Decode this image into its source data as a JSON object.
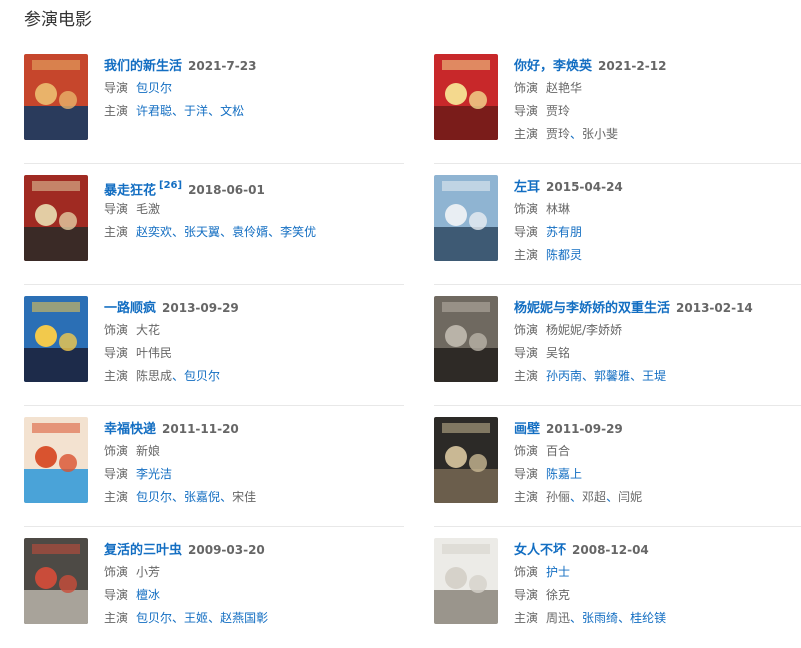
{
  "section_title": "参演电影",
  "films": [
    {
      "title": "我们的新生活",
      "sup": "",
      "date": "2021-7-23",
      "colors": [
        "#c6462c",
        "#e9b36a",
        "#2a3b5c"
      ],
      "rows": [
        {
          "label": "导演",
          "items": [
            {
              "text": "包贝尔",
              "link": true
            }
          ]
        },
        {
          "label": "主演",
          "items": [
            {
              "text": "许君聪",
              "link": true
            },
            {
              "text": "于洋",
              "link": true
            },
            {
              "text": "文松",
              "link": true
            }
          ]
        }
      ]
    },
    {
      "title": "你好，李焕英",
      "sup": "",
      "date": "2021-2-12",
      "colors": [
        "#c8282a",
        "#f4d98e",
        "#7a1c1a"
      ],
      "rows": [
        {
          "label": "饰演",
          "items": [
            {
              "text": "赵艳华",
              "link": false
            }
          ]
        },
        {
          "label": "导演",
          "items": [
            {
              "text": "贾玲",
              "link": false
            }
          ]
        },
        {
          "label": "主演",
          "items": [
            {
              "text": "贾玲",
              "link": false
            },
            {
              "text": "张小斐",
              "link": false
            }
          ]
        }
      ]
    },
    {
      "title": "暴走狂花",
      "sup": "[26]",
      "date": "2018-06-01",
      "colors": [
        "#a02a22",
        "#e3cda4",
        "#3a2a26"
      ],
      "rows": [
        {
          "label": "导演",
          "items": [
            {
              "text": "毛激",
              "link": false
            }
          ]
        },
        {
          "label": "主演",
          "items": [
            {
              "text": "赵奕欢",
              "link": true
            },
            {
              "text": "张天翼",
              "link": true
            },
            {
              "text": "袁伶婿",
              "link": true
            },
            {
              "text": "李笑优",
              "link": true
            }
          ]
        }
      ]
    },
    {
      "title": "左耳",
      "sup": "",
      "date": "2015-04-24",
      "colors": [
        "#8fb4d2",
        "#e9eef3",
        "#3e5a74"
      ],
      "rows": [
        {
          "label": "饰演",
          "items": [
            {
              "text": "林琳",
              "link": false
            }
          ]
        },
        {
          "label": "导演",
          "items": [
            {
              "text": "苏有朋",
              "link": true
            }
          ]
        },
        {
          "label": "主演",
          "items": [
            {
              "text": "陈都灵",
              "link": true
            }
          ]
        }
      ]
    },
    {
      "title": "一路顺疯",
      "sup": "",
      "date": "2013-09-29",
      "colors": [
        "#2b6fb5",
        "#f2c94c",
        "#1d2b4a"
      ],
      "rows": [
        {
          "label": "饰演",
          "items": [
            {
              "text": "大花",
              "link": false
            }
          ]
        },
        {
          "label": "导演",
          "items": [
            {
              "text": "叶伟民",
              "link": false
            }
          ]
        },
        {
          "label": "主演",
          "items": [
            {
              "text": "陈思成",
              "link": false
            },
            {
              "text": "包贝尔",
              "link": true
            }
          ]
        }
      ]
    },
    {
      "title": "杨妮妮与李娇娇的双重生活",
      "sup": "",
      "date": "2013-02-14",
      "colors": [
        "#6f6960",
        "#b9b3a8",
        "#2e2a26"
      ],
      "rows": [
        {
          "label": "饰演",
          "items": [
            {
              "text": "杨妮妮/李娇娇",
              "link": false
            }
          ]
        },
        {
          "label": "导演",
          "items": [
            {
              "text": "吴铭",
              "link": false
            }
          ]
        },
        {
          "label": "主演",
          "items": [
            {
              "text": "孙丙南",
              "link": true
            },
            {
              "text": "郭馨雅",
              "link": true
            },
            {
              "text": "王堤",
              "link": true
            }
          ]
        }
      ]
    },
    {
      "title": "幸福快递",
      "sup": "",
      "date": "2011-11-20",
      "colors": [
        "#f3e2d0",
        "#d9532f",
        "#4aa3d8"
      ],
      "rows": [
        {
          "label": "饰演",
          "items": [
            {
              "text": "新娘",
              "link": false
            }
          ]
        },
        {
          "label": "导演",
          "items": [
            {
              "text": "李光洁",
              "link": true
            }
          ]
        },
        {
          "label": "主演",
          "items": [
            {
              "text": "包贝尔",
              "link": true
            },
            {
              "text": "张嘉倪",
              "link": true
            },
            {
              "text": "宋佳",
              "link": false
            }
          ]
        }
      ]
    },
    {
      "title": "画壁",
      "sup": "",
      "date": "2011-09-29",
      "colors": [
        "#2c2a27",
        "#c9b894",
        "#6b5e4c"
      ],
      "rows": [
        {
          "label": "饰演",
          "items": [
            {
              "text": "百合",
              "link": false
            }
          ]
        },
        {
          "label": "导演",
          "items": [
            {
              "text": "陈嘉上",
              "link": true
            }
          ]
        },
        {
          "label": "主演",
          "items": [
            {
              "text": "孙俪",
              "link": false
            },
            {
              "text": "邓超",
              "link": false
            },
            {
              "text": "闫妮",
              "link": false
            }
          ]
        }
      ]
    },
    {
      "title": "复活的三叶虫",
      "sup": "",
      "date": "2009-03-20",
      "colors": [
        "#4d4a45",
        "#c94c3a",
        "#a8a39a"
      ],
      "rows": [
        {
          "label": "饰演",
          "items": [
            {
              "text": "小芳",
              "link": false
            }
          ]
        },
        {
          "label": "导演",
          "items": [
            {
              "text": "檀冰",
              "link": true
            }
          ]
        },
        {
          "label": "主演",
          "items": [
            {
              "text": "包贝尔",
              "link": true
            },
            {
              "text": "王姬",
              "link": true
            },
            {
              "text": "赵燕国彰",
              "link": true
            }
          ]
        }
      ]
    },
    {
      "title": "女人不坏",
      "sup": "",
      "date": "2008-12-04",
      "colors": [
        "#ecebe7",
        "#d6d2ca",
        "#9a958c"
      ],
      "rows": [
        {
          "label": "饰演",
          "items": [
            {
              "text": "护士",
              "link": true
            }
          ]
        },
        {
          "label": "导演",
          "items": [
            {
              "text": "徐克",
              "link": false
            }
          ]
        },
        {
          "label": "主演",
          "items": [
            {
              "text": "周迅",
              "link": false
            },
            {
              "text": "张雨绮",
              "link": true
            },
            {
              "text": "桂纶镁",
              "link": true
            }
          ]
        }
      ]
    }
  ]
}
